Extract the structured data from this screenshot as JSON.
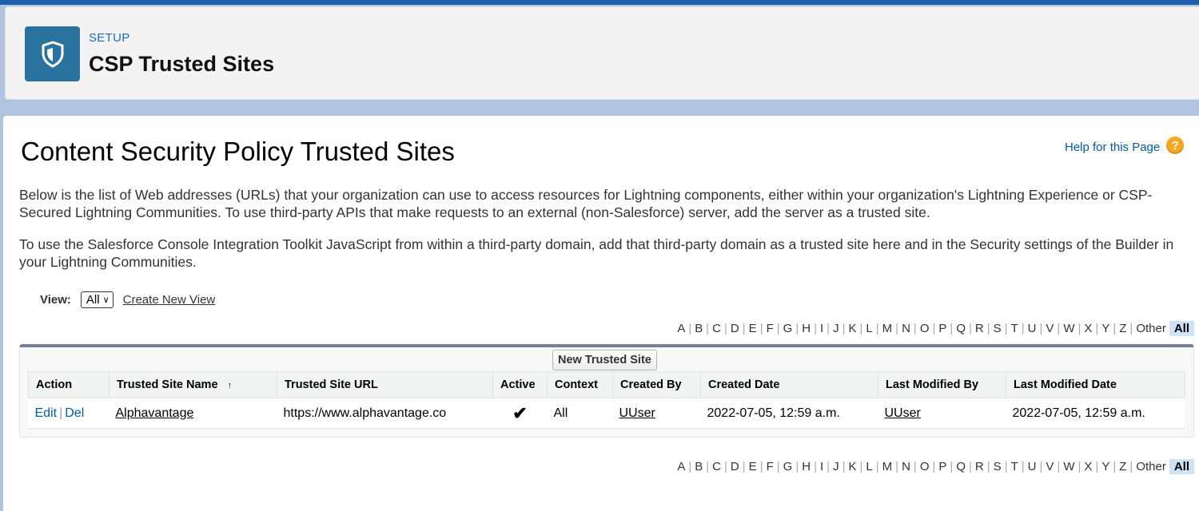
{
  "header": {
    "eyebrow": "SETUP",
    "title": "CSP Trusted Sites",
    "icon": "shield-icon"
  },
  "page": {
    "title": "Content Security Policy Trusted Sites",
    "help_label": "Help for this Page",
    "help_icon_glyph": "?",
    "description_1": "Below is the list of Web addresses (URLs) that your organization can use to access resources for Lightning components, either within your organization's Lightning Experience or CSP-Secured Lightning Communities. To use third-party APIs that make requests to an external (non-Salesforce) server, add the server as a trusted site.",
    "description_2": "To use the Salesforce Console Integration Toolkit JavaScript from within a third-party domain, add that third-party domain as a trusted site here and in the Security settings of the Builder in your Lightning Communities."
  },
  "view": {
    "label": "View:",
    "selected": "All",
    "create_link": "Create New View"
  },
  "alpha_filter": {
    "letters": [
      "A",
      "B",
      "C",
      "D",
      "E",
      "F",
      "G",
      "H",
      "I",
      "J",
      "K",
      "L",
      "M",
      "N",
      "O",
      "P",
      "Q",
      "R",
      "S",
      "T",
      "U",
      "V",
      "W",
      "X",
      "Y",
      "Z",
      "Other"
    ],
    "active": "All"
  },
  "list": {
    "new_button": "New Trusted Site",
    "columns": {
      "action": "Action",
      "name": "Trusted Site Name",
      "url": "Trusted Site URL",
      "active": "Active",
      "context": "Context",
      "created_by": "Created By",
      "created_date": "Created Date",
      "modified_by": "Last Modified By",
      "modified_date": "Last Modified Date"
    },
    "rows": [
      {
        "edit": "Edit",
        "del": "Del",
        "name": "Alphavantage",
        "url": "https://www.alphavantage.co",
        "active_mark": "✔",
        "context": "All",
        "created_by": "UUser",
        "created_date": "2022-07-05, 12:59 a.m.",
        "modified_by": "UUser",
        "modified_date": "2022-07-05, 12:59 a.m."
      }
    ]
  },
  "colors": {
    "brand_blue": "#1b5fa8",
    "icon_bg": "#2a739e",
    "link": "#015ba7",
    "help_orange": "#f6a623"
  }
}
